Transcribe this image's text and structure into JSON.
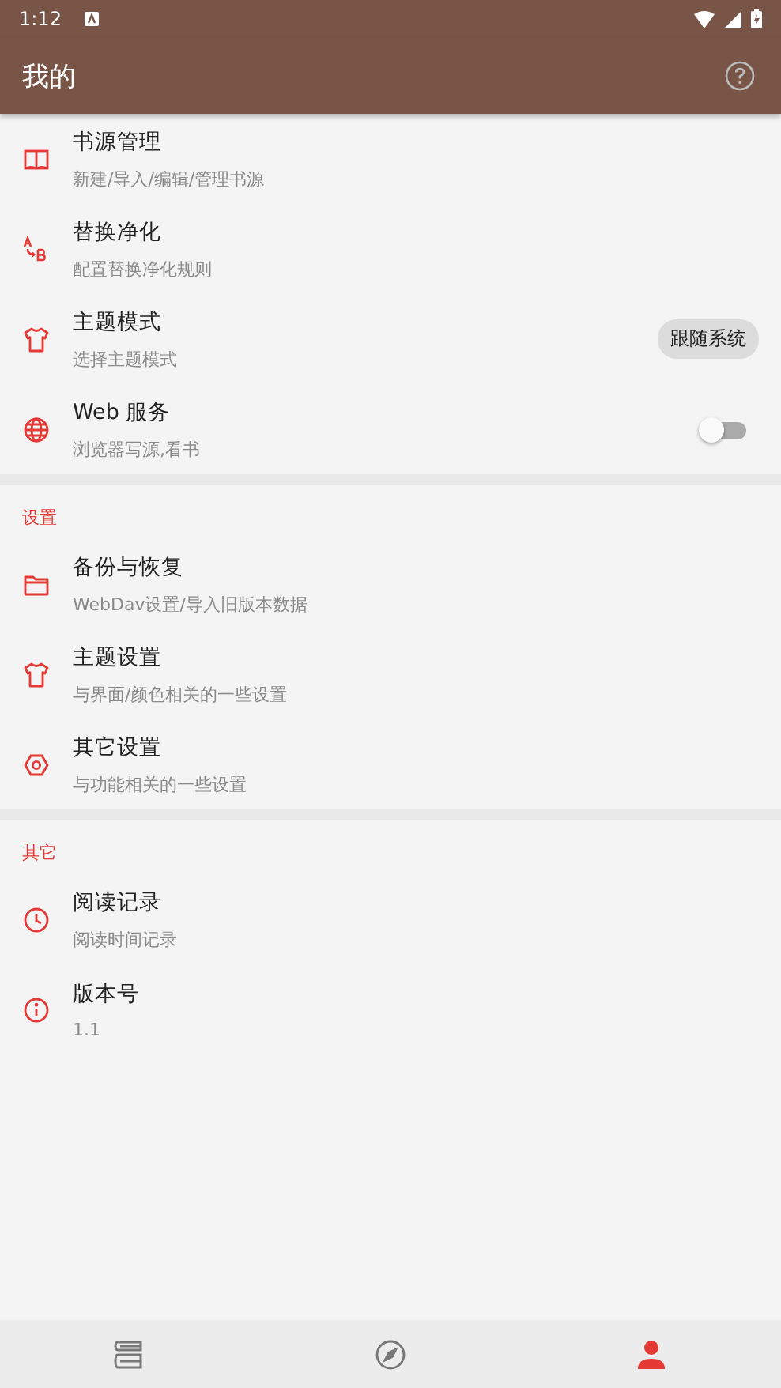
{
  "status_bar": {
    "time": "1:12"
  },
  "app_bar": {
    "title": "我的"
  },
  "sections": [
    {
      "items": [
        {
          "kind": "plain",
          "title": "书源管理",
          "subtitle": "新建/导入/编辑/管理书源"
        },
        {
          "kind": "plain",
          "title": "替换净化",
          "subtitle": "配置替换净化规则"
        },
        {
          "kind": "chip",
          "title": "主题模式",
          "subtitle": "选择主题模式",
          "value": "跟随系统"
        },
        {
          "kind": "switch",
          "title": "Web 服务",
          "subtitle": "浏览器写源,看书",
          "on": false
        }
      ]
    },
    {
      "header": "设置",
      "items": [
        {
          "kind": "plain",
          "title": "备份与恢复",
          "subtitle": "WebDav设置/导入旧版本数据"
        },
        {
          "kind": "plain",
          "title": "主题设置",
          "subtitle": "与界面/颜色相关的一些设置"
        },
        {
          "kind": "plain",
          "title": "其它设置",
          "subtitle": "与功能相关的一些设置"
        }
      ]
    },
    {
      "header": "其它",
      "items": [
        {
          "kind": "plain",
          "title": "阅读记录",
          "subtitle": "阅读时间记录"
        },
        {
          "kind": "plain",
          "title": "版本号",
          "subtitle": "1.1"
        }
      ]
    }
  ],
  "bottom_nav": [
    {
      "selected": false
    },
    {
      "selected": false
    },
    {
      "selected": true
    }
  ]
}
